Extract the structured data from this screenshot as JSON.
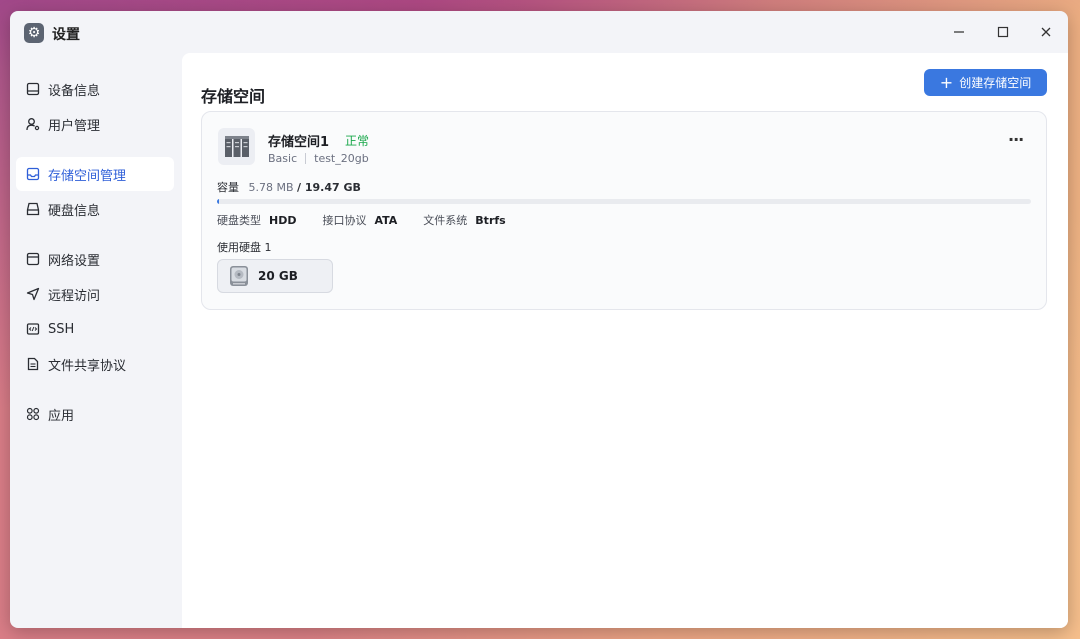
{
  "window": {
    "title": "设置"
  },
  "sidebar": {
    "items": [
      {
        "label": "设备信息",
        "icon": "monitor-icon"
      },
      {
        "label": "用户管理",
        "icon": "user-icon"
      },
      {
        "label": "存储空间管理",
        "icon": "inbox-icon",
        "active": true
      },
      {
        "label": "硬盘信息",
        "icon": "hard-drive-icon"
      },
      {
        "label": "网络设置",
        "icon": "network-window-icon"
      },
      {
        "label": "远程访问",
        "icon": "send-icon"
      },
      {
        "label": "SSH",
        "icon": "code-icon"
      },
      {
        "label": "文件共享协议",
        "icon": "document-icon"
      },
      {
        "label": "应用",
        "icon": "apps-icon"
      }
    ]
  },
  "main": {
    "title": "存储空间",
    "create_button": "创建存储空间",
    "card": {
      "name": "存储空间1",
      "status": "正常",
      "type": "Basic",
      "disk_group": "test_20gb",
      "capacity_label": "容量",
      "used": "5.78 MB",
      "total": "/ 19.47 GB",
      "usage_fraction": 0.0003,
      "props": [
        {
          "label": "硬盘类型",
          "value": "HDD"
        },
        {
          "label": "接口协议",
          "value": "ATA"
        },
        {
          "label": "文件系统",
          "value": "Btrfs"
        }
      ],
      "used_disks_label": "使用硬盘 1",
      "disk_size": "20 GB"
    }
  },
  "colors": {
    "accent": "#3a78e0",
    "status_ok": "#1aa84b"
  }
}
